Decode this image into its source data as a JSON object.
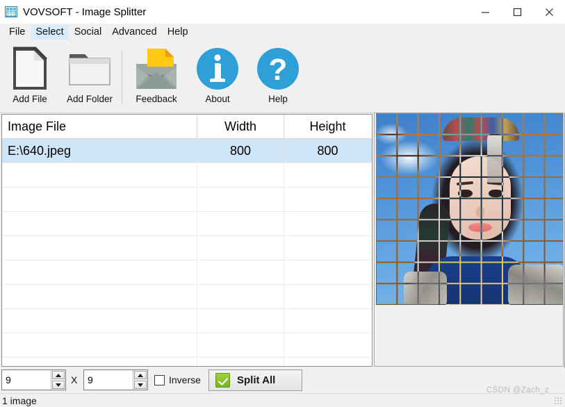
{
  "window": {
    "title": "VOVSOFT - Image Splitter",
    "icon": "app-grid-icon",
    "controls": {
      "minimize": "minimize-icon",
      "maximize": "maximize-icon",
      "close": "close-icon"
    }
  },
  "menubar": {
    "items": [
      {
        "label": "File",
        "active": false
      },
      {
        "label": "Select",
        "active": true
      },
      {
        "label": "Social",
        "active": false
      },
      {
        "label": "Advanced",
        "active": false
      },
      {
        "label": "Help",
        "active": false
      }
    ]
  },
  "toolbar": {
    "buttons": [
      {
        "label": "Add File",
        "icon": "file-document-icon"
      },
      {
        "label": "Add Folder",
        "icon": "folder-icon"
      },
      {
        "label": "Feedback",
        "icon": "envelope-mail-icon"
      },
      {
        "label": "About",
        "icon": "info-circle-icon"
      },
      {
        "label": "Help",
        "icon": "question-circle-icon"
      }
    ]
  },
  "file_list": {
    "columns": [
      "Image File",
      "Width",
      "Height"
    ],
    "rows": [
      {
        "name": "E:\\640.jpeg",
        "width": "800",
        "height": "800",
        "selected": true
      }
    ],
    "empty_row_count": 9
  },
  "preview": {
    "alt": "portrait photo with 9 by 9 split grid overlay",
    "grid_cols": 9,
    "grid_rows": 9
  },
  "bottom_bar": {
    "cols_value": "9",
    "rows_value": "9",
    "separator": "X",
    "inverse_label": "Inverse",
    "inverse_checked": false,
    "split_button_label": "Split All"
  },
  "statusbar": {
    "text": "1 image"
  },
  "watermark": {
    "text": "CSDN @Zach_z"
  },
  "colors": {
    "accent_blue": "#2f9fd8",
    "selection_blue": "#cfe5f8",
    "menu_highlight": "#d8ecfb",
    "check_green": "#76b51f",
    "window_bg": "#f0f0f0"
  }
}
